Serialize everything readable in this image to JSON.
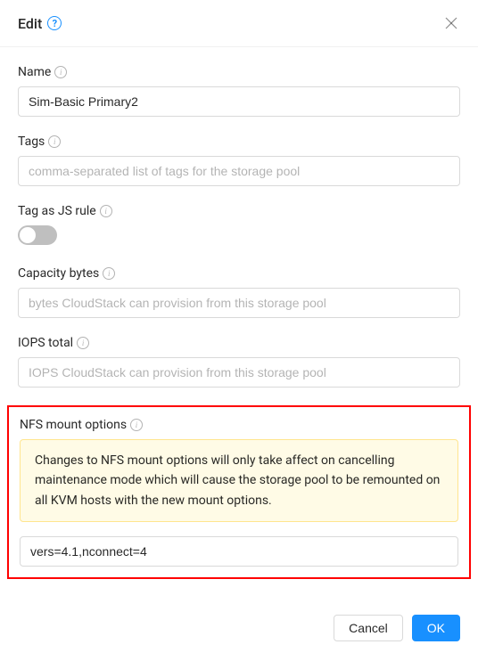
{
  "header": {
    "title": "Edit"
  },
  "form": {
    "name": {
      "label": "Name",
      "value": "Sim-Basic Primary2"
    },
    "tags": {
      "label": "Tags",
      "placeholder": "comma-separated list of tags for the storage pool",
      "value": ""
    },
    "js_rule": {
      "label": "Tag as JS rule"
    },
    "capacity": {
      "label": "Capacity bytes",
      "placeholder": "bytes CloudStack can provision from this storage pool",
      "value": ""
    },
    "iops": {
      "label": "IOPS total",
      "placeholder": "IOPS CloudStack can provision from this storage pool",
      "value": ""
    },
    "nfs": {
      "label": "NFS mount options",
      "warning": "Changes to NFS mount options will only take affect on cancelling maintenance mode which will cause the storage pool to be remounted on all KVM hosts with the new mount options.",
      "value": "vers=4.1,nconnect=4"
    }
  },
  "footer": {
    "cancel": "Cancel",
    "ok": "OK"
  }
}
